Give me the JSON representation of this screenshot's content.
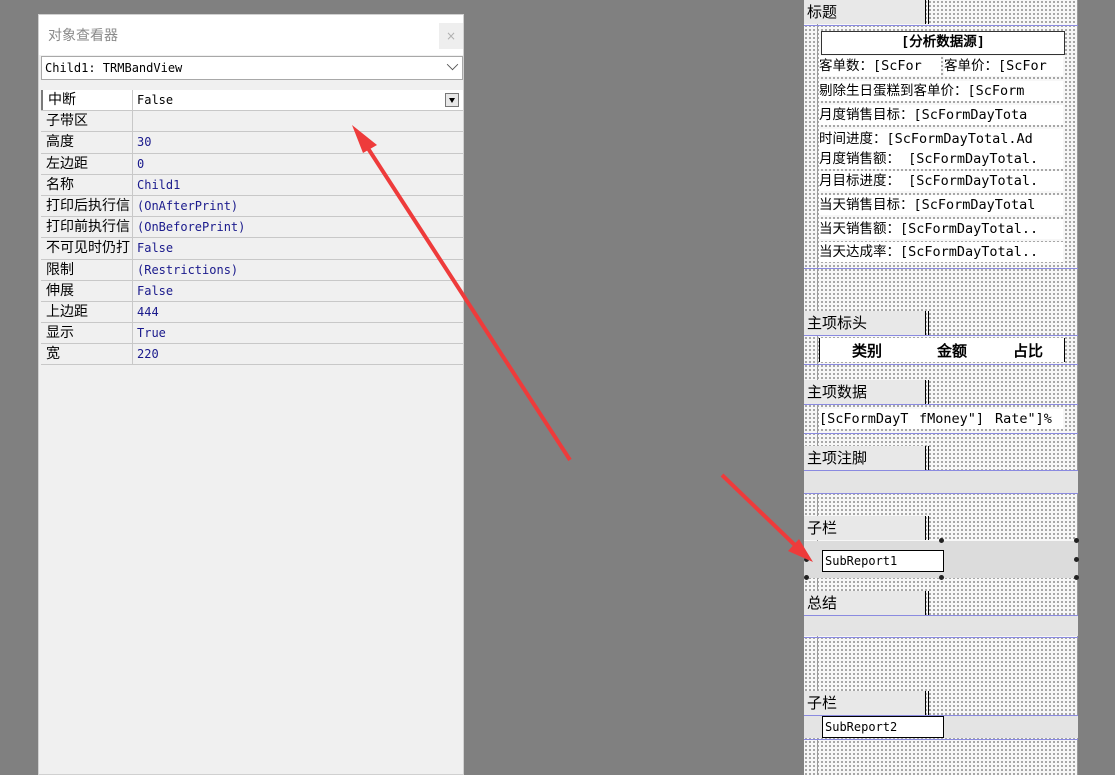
{
  "inspector": {
    "title": "对象查看器",
    "close": "×",
    "combo": "Child1: TRMBandView",
    "properties": [
      {
        "name": "中断",
        "value": "False"
      },
      {
        "name": "子带区",
        "value": ""
      },
      {
        "name": "高度",
        "value": "30"
      },
      {
        "name": "左边距",
        "value": "0"
      },
      {
        "name": "名称",
        "value": "Child1"
      },
      {
        "name": "打印后执行信",
        "value": "(OnAfterPrint)"
      },
      {
        "name": "打印前执行信",
        "value": "(OnBeforePrint)"
      },
      {
        "name": "不可见时仍打",
        "value": "False"
      },
      {
        "name": "限制",
        "value": "(Restrictions)"
      },
      {
        "name": "伸展",
        "value": "False"
      },
      {
        "name": "上边距",
        "value": "444"
      },
      {
        "name": "显示",
        "value": "True"
      },
      {
        "name": "宽",
        "value": "220"
      }
    ]
  },
  "designer": {
    "bands": {
      "title": "标题",
      "master_header": "主项标头",
      "master_data": "主项数据",
      "master_footer": "主项注脚",
      "child1": "子栏",
      "summary": "总结",
      "child2": "子栏"
    },
    "title_fields": [
      "[分析数据源]",
      "客单数：[ScFor",
      "客单价：[ScFor",
      "剔除生日蛋糕到客单价：[ScForm",
      "月度销售目标：[ScFormDayTota",
      "时间进度：[ScFormDayTotal.Ad",
      "月度销售额： [ScFormDayTotal.",
      "月目标进度： [ScFormDayTotal.",
      "当天销售目标：[ScFormDayTotal",
      "当天销售额：[ScFormDayTotal..",
      "当天达成率：[ScFormDayTotal.."
    ],
    "header_cols": [
      "类别",
      "金额",
      "占比"
    ],
    "data_fields": [
      "[ScFormDayT",
      "fMoney\"]",
      "Rate\"]%"
    ],
    "subreport1": "SubReport1",
    "subreport2": "SubReport2"
  },
  "colors": {
    "arrow": "#ee3b3b",
    "band_line": "#8a8ae0",
    "value_text": "#1a1a8c"
  }
}
